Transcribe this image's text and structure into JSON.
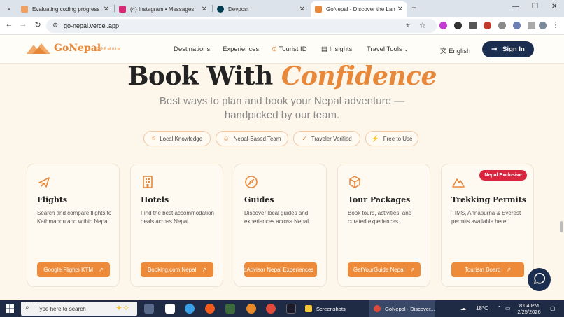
{
  "browser": {
    "tabs": [
      {
        "title": "Evaluating coding progress as a",
        "color": "#e8883a"
      },
      {
        "title": "(4) Instagram • Messages",
        "color": "#d62976"
      },
      {
        "title": "Devpost",
        "color": "#003e54"
      },
      {
        "title": "GoNepal - Discover the Land of",
        "color": "#e8883a",
        "active": true
      }
    ],
    "url": "go-nepal.vercel.app"
  },
  "header": {
    "logo_text": "GoNepal",
    "logo_badge": "PREMIUM",
    "nav": [
      {
        "label": "Destinations"
      },
      {
        "label": "Experiences"
      },
      {
        "label": "Tourist ID"
      },
      {
        "label": "Insights"
      },
      {
        "label": "Travel Tools"
      }
    ],
    "language": "English",
    "signin": "Sign In"
  },
  "hero": {
    "title_plain": "Book With",
    "title_accent": "Confidence",
    "subtitle": "Best ways to plan and book your Nepal adventure — handpicked by our team."
  },
  "chips": [
    {
      "label": "Local Knowledge",
      "icon": "pin-icon"
    },
    {
      "label": "Nepal-Based Team",
      "icon": "users-icon"
    },
    {
      "label": "Traveler Verified",
      "icon": "check-circle-icon"
    },
    {
      "label": "Free to Use",
      "icon": "zap-icon"
    }
  ],
  "cards": [
    {
      "title": "Flights",
      "description": "Search and compare flights to Kathmandu and within Nepal.",
      "button": "Google Flights KTM",
      "icon": "plane-icon"
    },
    {
      "title": "Hotels",
      "description": "Find the best accommodation deals across Nepal.",
      "button": "Booking.com Nepal",
      "icon": "building-icon"
    },
    {
      "title": "Guides",
      "description": "Discover local guides and experiences across Nepal.",
      "button": "TripAdvisor Nepal Experiences",
      "icon": "compass-icon"
    },
    {
      "title": "Tour Packages",
      "description": "Book tours, activities, and curated experiences.",
      "button": "GetYourGuide Nepal",
      "icon": "package-icon"
    },
    {
      "title": "Trekking Permits",
      "description": "TIMS, Annapurna & Everest permits available here.",
      "button": "Tourism Board",
      "icon": "mountain-icon"
    }
  ],
  "badge": "Nepal Exclusive",
  "taskbar": {
    "search_placeholder": "Type here to search",
    "groups": [
      {
        "label": "Screenshots"
      },
      {
        "label": "GoNepal - Discover..."
      }
    ],
    "temperature": "18°C",
    "time": "8:04 PM",
    "date": "2/25/2026"
  },
  "colors": {
    "accent": "#e8883a",
    "navy": "#1c2e4f",
    "badge_red": "#d7263d"
  }
}
